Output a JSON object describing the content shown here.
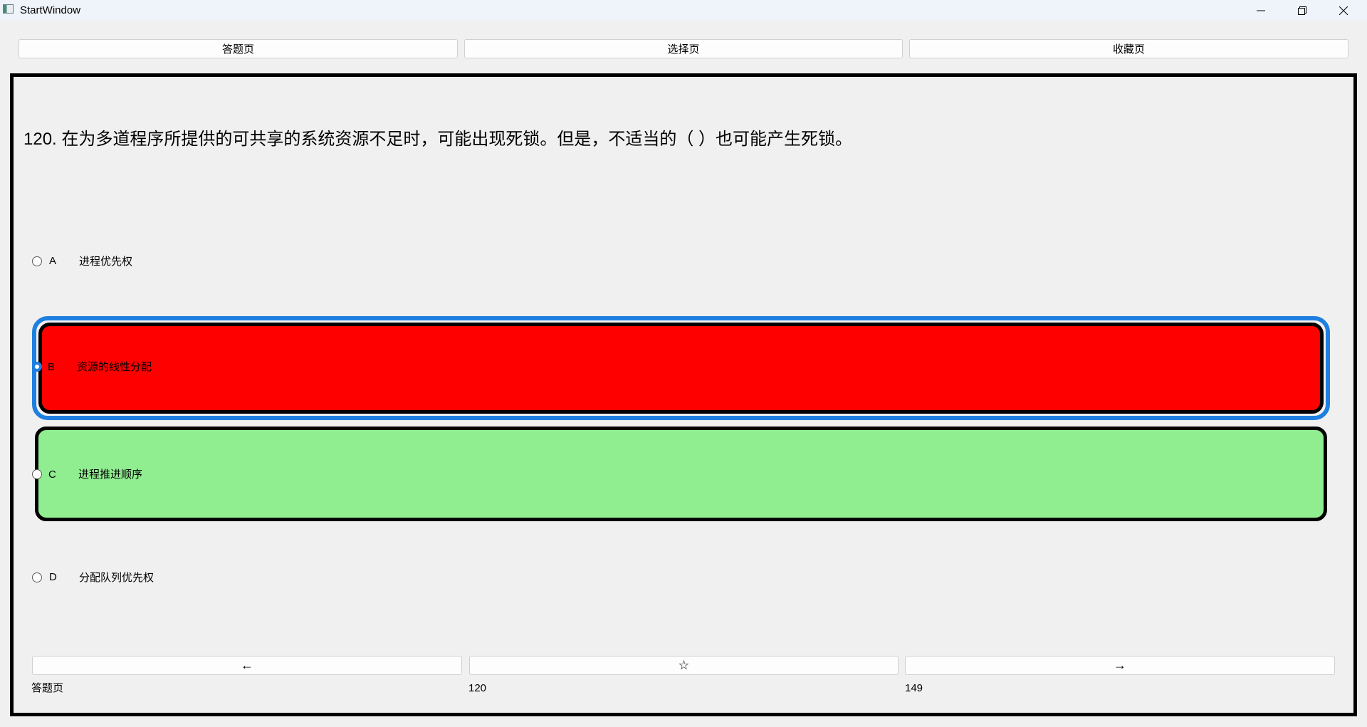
{
  "window": {
    "title": "StartWindow"
  },
  "top_nav": {
    "answer_page": "答题页",
    "select_page": "选择页",
    "favorites_page": "收藏页"
  },
  "question": {
    "text": "120. 在为多道程序所提供的可共享的系统资源不足时，可能出现死锁。但是，不适当的（ ）也可能产生死锁。"
  },
  "options": [
    {
      "letter": "A",
      "text": "进程优先权",
      "checked": false,
      "state": "normal"
    },
    {
      "letter": "B",
      "text": "资源的线性分配",
      "checked": true,
      "state": "wrong",
      "color": "#ff0000"
    },
    {
      "letter": "C",
      "text": "进程推进顺序",
      "checked": false,
      "state": "correct",
      "color": "#90ee90"
    },
    {
      "letter": "D",
      "text": "分配队列优先权",
      "checked": false,
      "state": "normal"
    }
  ],
  "selection_highlight_color": "#1e7fe0",
  "nav": {
    "prev_label": "←",
    "star_label": "☆",
    "next_label": "→"
  },
  "footer": {
    "page_name": "答题页",
    "current_number": "120",
    "total": "149"
  }
}
